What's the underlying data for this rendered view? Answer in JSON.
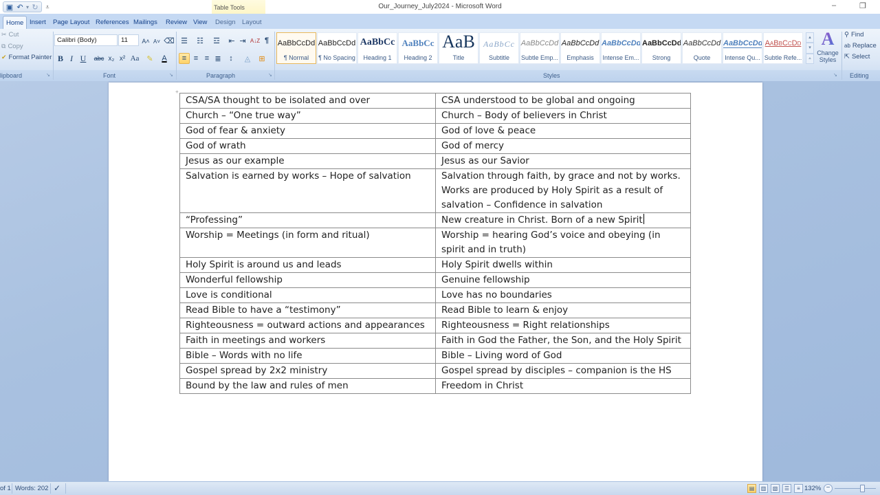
{
  "window": {
    "title": "Our_Journey_July2024 - Microsoft Word",
    "context_tab_group": "Table Tools",
    "minimize_glyph": "–",
    "restore_glyph": "❐"
  },
  "quick_access": {
    "save_icon": "save-icon",
    "undo_icon": "undo-icon",
    "redo_icon": "redo-icon",
    "customize_icon": "customize-qat-icon"
  },
  "tabs": [
    {
      "label": "Home",
      "active": true
    },
    {
      "label": "Insert"
    },
    {
      "label": "Page Layout"
    },
    {
      "label": "References"
    },
    {
      "label": "Mailings"
    },
    {
      "label": "Review"
    },
    {
      "label": "View"
    },
    {
      "label": "Design",
      "contextual": true
    },
    {
      "label": "Layout",
      "contextual": true
    }
  ],
  "ribbon": {
    "clipboard": {
      "label": "lipboard",
      "cut": "Cut",
      "copy": "Copy",
      "format_painter": "Format Painter"
    },
    "font": {
      "label": "Font",
      "font_name": "Calibri (Body)",
      "font_size": "11",
      "bold": "B",
      "italic": "I",
      "underline": "U",
      "strikethrough": "abc",
      "subscript": "x₂",
      "superscript": "x²",
      "change_case": "Aa",
      "grow_font": "A˄",
      "shrink_font": "A˅"
    },
    "paragraph": {
      "label": "Paragraph",
      "show_marks": "¶",
      "sort": "A↓Z"
    },
    "styles": {
      "label": "Styles",
      "items": [
        {
          "sample": "AaBbCcDd",
          "name": "¶ Normal",
          "selected": true
        },
        {
          "sample": "AaBbCcDd",
          "name": "¶ No Spacing"
        },
        {
          "sample": "AaBbCc",
          "name": "Heading 1"
        },
        {
          "sample": "AaBbCc",
          "name": "Heading 2"
        },
        {
          "sample": "AaB",
          "name": "Title"
        },
        {
          "sample": "AaBbCc",
          "name": "Subtitle"
        },
        {
          "sample": "AaBbCcDd",
          "name": "Subtle Emp..."
        },
        {
          "sample": "AaBbCcDd",
          "name": "Emphasis"
        },
        {
          "sample": "AaBbCcDd",
          "name": "Intense Em..."
        },
        {
          "sample": "AaBbCcDd",
          "name": "Strong"
        },
        {
          "sample": "AaBbCcDd",
          "name": "Quote"
        },
        {
          "sample": "AaBbCcDd",
          "name": "Intense Qu..."
        },
        {
          "sample": "AaBbCcDd",
          "name": "Subtle Refe..."
        }
      ],
      "change_styles": "Change Styles"
    },
    "editing": {
      "label": "Editing",
      "find": "Find",
      "replace": "Replace",
      "select": "Select"
    }
  },
  "document": {
    "table": [
      [
        "CSA/SA thought to be isolated and over",
        "CSA understood to be global and ongoing"
      ],
      [
        "Church – “One true way”",
        "Church – Body of believers in Christ"
      ],
      [
        "God of fear & anxiety",
        "God of love & peace"
      ],
      [
        "God of wrath",
        "God of mercy"
      ],
      [
        "Jesus as our example",
        "Jesus as our Savior"
      ],
      [
        "Salvation is earned by works – Hope of salvation",
        "Salvation through faith, by grace and not by works. Works are produced by Holy Spirit as a result of salvation – Confidence in salvation"
      ],
      [
        "“Professing”",
        "New creature in Christ. Born of a new Spirit"
      ],
      [
        "Worship = Meetings (in form and ritual)",
        "Worship = hearing God’s voice and obeying (in spirit and in truth)"
      ],
      [
        "Holy Spirit is around us and leads",
        "Holy Spirit dwells within"
      ],
      [
        "Wonderful fellowship",
        "Genuine fellowship"
      ],
      [
        "Love is conditional",
        "Love has no boundaries"
      ],
      [
        "Read Bible to have a “testimony”",
        "Read Bible to learn & enjoy"
      ],
      [
        "Righteousness = outward actions and appearances",
        "Righteousness = Right relationships"
      ],
      [
        "Faith in meetings and workers",
        "Faith in God the Father, the Son, and the Holy Spirit"
      ],
      [
        "Bible – Words with no life",
        "Bible – Living word of God"
      ],
      [
        "Gospel spread by 2x2 ministry",
        "Gospel spread by disciples – companion is the HS"
      ],
      [
        "Bound by the law and rules of men",
        "Freedom in Christ"
      ]
    ]
  },
  "statusbar": {
    "page": "of 1",
    "words": "Words: 202",
    "zoom": "132%",
    "zoom_fraction": 0.66
  }
}
